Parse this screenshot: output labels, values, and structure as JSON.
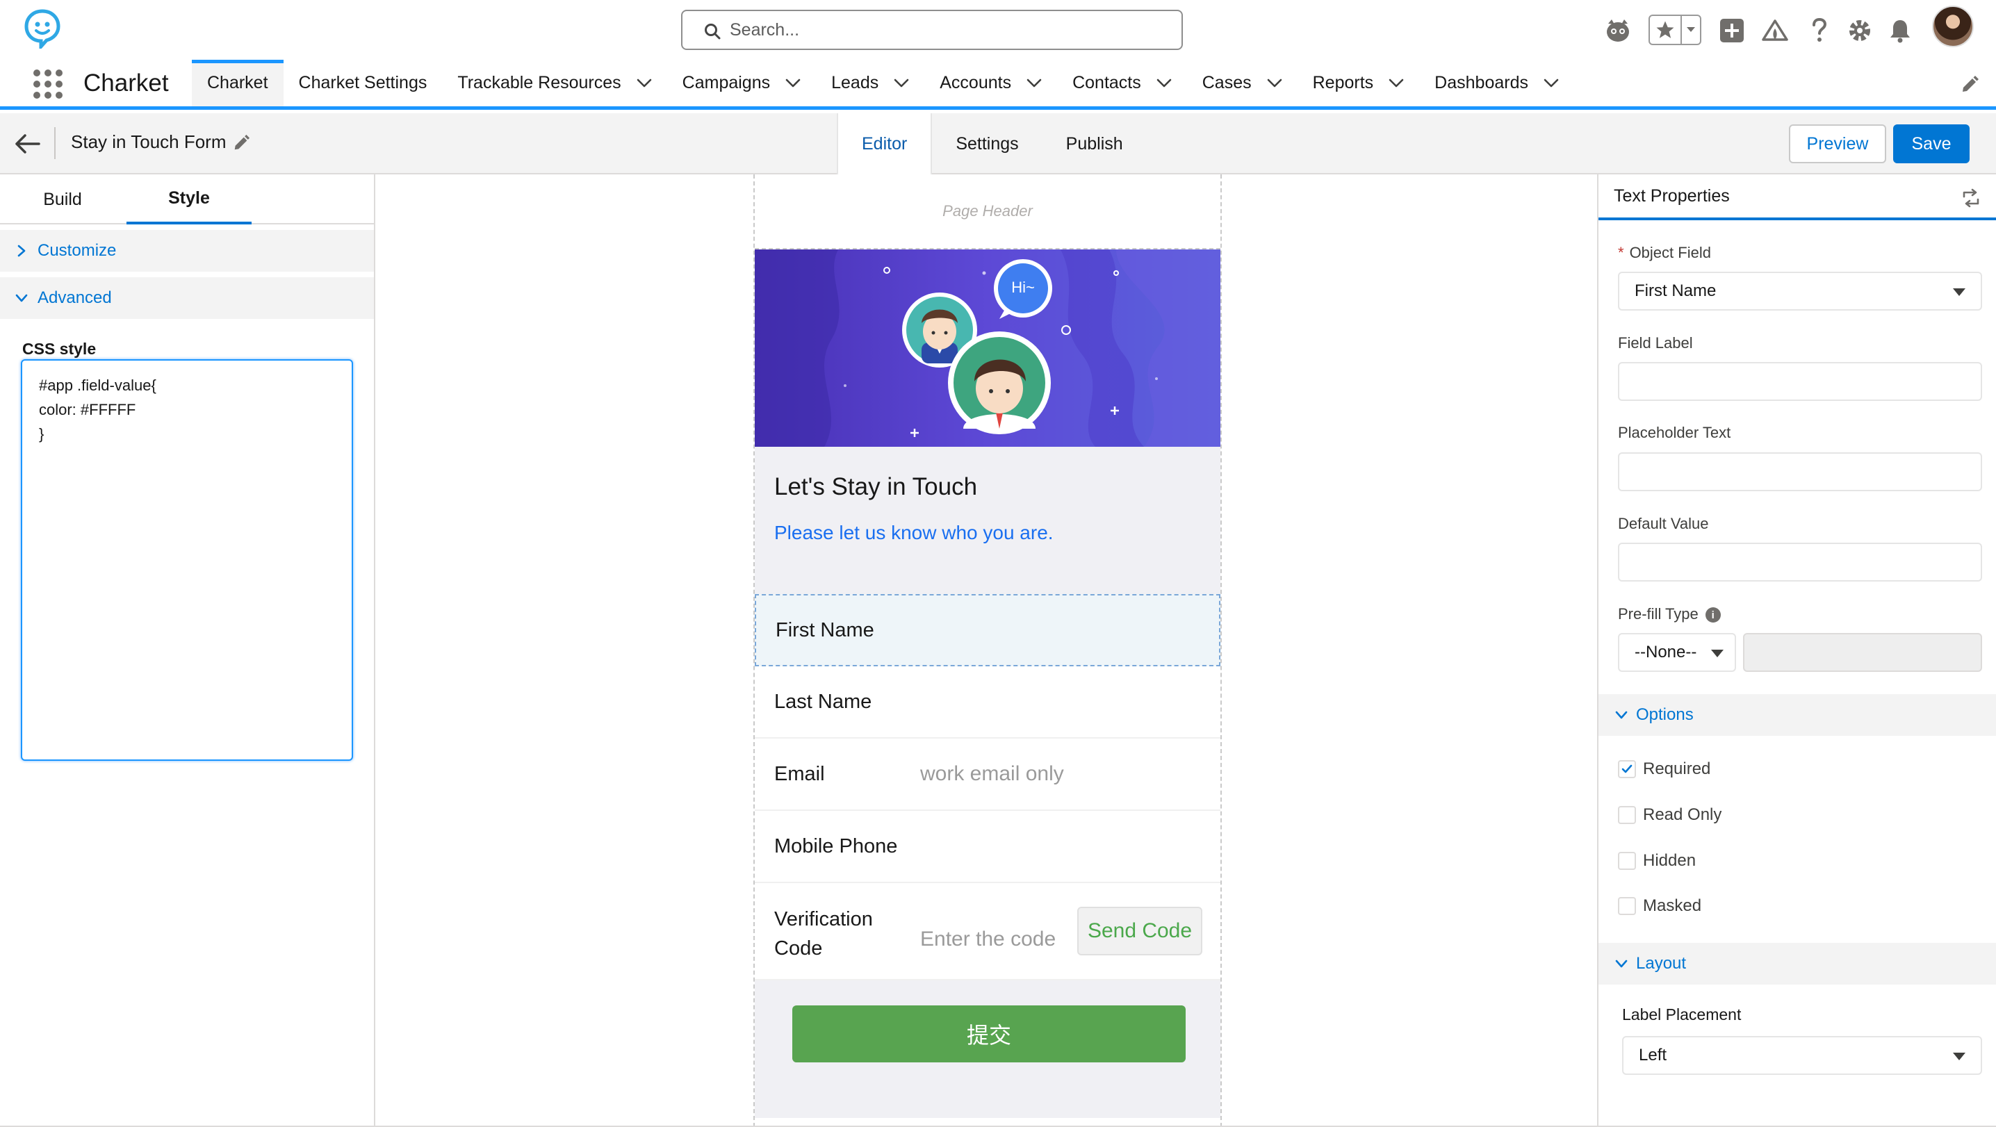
{
  "global_header": {
    "search_placeholder": "Search...",
    "icons": [
      "charket-logo-icon",
      "search-icon",
      "assistant-bot-icon",
      "favorites-star-icon",
      "favorites-dropdown-icon",
      "global-add-icon",
      "trailhead-icon",
      "help-icon",
      "setup-gear-icon",
      "notifications-bell-icon",
      "user-avatar"
    ]
  },
  "nav": {
    "app_name": "Charket",
    "items": [
      {
        "label": "Charket",
        "active": true,
        "has_menu": false
      },
      {
        "label": "Charket Settings",
        "active": false,
        "has_menu": false
      },
      {
        "label": "Trackable Resources",
        "active": false,
        "has_menu": true
      },
      {
        "label": "Campaigns",
        "active": false,
        "has_menu": true
      },
      {
        "label": "Leads",
        "active": false,
        "has_menu": true
      },
      {
        "label": "Accounts",
        "active": false,
        "has_menu": true
      },
      {
        "label": "Contacts",
        "active": false,
        "has_menu": true
      },
      {
        "label": "Cases",
        "active": false,
        "has_menu": true
      },
      {
        "label": "Reports",
        "active": false,
        "has_menu": true
      },
      {
        "label": "Dashboards",
        "active": false,
        "has_menu": true
      }
    ]
  },
  "builder": {
    "form_title": "Stay in Touch Form",
    "tabs": [
      "Editor",
      "Settings",
      "Publish"
    ],
    "active_tab": "Editor",
    "preview_label": "Preview",
    "save_label": "Save"
  },
  "left_panel": {
    "tabs": [
      "Build",
      "Style"
    ],
    "active_tab": "Style",
    "customize_label": "Customize",
    "advanced_label": "Advanced",
    "css_label": "CSS style",
    "css_value": "#app .field-value{\ncolor: #FFFFF\n}"
  },
  "form_preview": {
    "page_header_placeholder": "Page Header",
    "hero_bubble": "Hi~",
    "heading": "Let's Stay in Touch",
    "subheading": "Please let us know who you are.",
    "fields": [
      {
        "label": "First Name",
        "placeholder": "",
        "selected": true
      },
      {
        "label": "Last Name",
        "placeholder": "",
        "selected": false
      },
      {
        "label": "Email",
        "placeholder": "work email only",
        "selected": false
      },
      {
        "label": "Mobile Phone",
        "placeholder": "",
        "selected": false
      }
    ],
    "verification": {
      "label": "Verification Code",
      "placeholder": "Enter the code",
      "button": "Send Code"
    },
    "submit_label": "提交"
  },
  "properties": {
    "title": "Text Properties",
    "object_field_label": "Object Field",
    "object_field_value": "First Name",
    "field_label_label": "Field Label",
    "field_label_value": "",
    "placeholder_label": "Placeholder Text",
    "placeholder_value": "",
    "default_value_label": "Default Value",
    "default_value_value": "",
    "prefill_type_label": "Pre-fill Type",
    "prefill_type_value": "--None--",
    "options_label": "Options",
    "options": [
      {
        "label": "Required",
        "checked": true
      },
      {
        "label": "Read Only",
        "checked": false
      },
      {
        "label": "Hidden",
        "checked": false
      },
      {
        "label": "Masked",
        "checked": false
      }
    ],
    "layout_label": "Layout",
    "label_placement_label": "Label Placement",
    "label_placement_value": "Left"
  },
  "colors": {
    "brand_blue": "#0176d3",
    "nav_accent": "#1b96ff",
    "submit_green": "#58a450",
    "hero_purple": "#4830b5"
  }
}
